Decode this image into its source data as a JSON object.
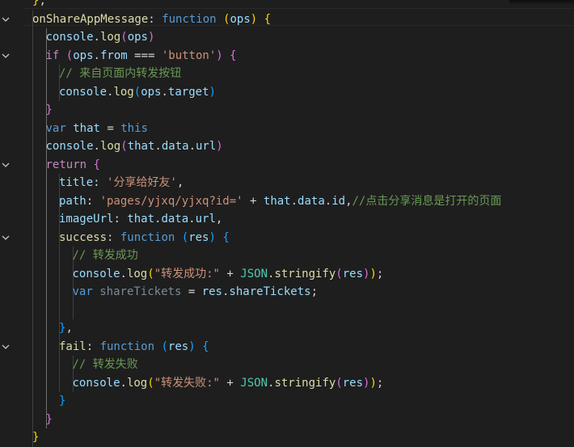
{
  "code_lines": [
    "},",
    "onShareAppMessage: function (ops) {",
    "console.log(ops)",
    "if (ops.from === 'button') {",
    "// 来自页面内转发按钮",
    "console.log(ops.target)",
    "}",
    "var that = this",
    "console.log(that.data.url)",
    "return {",
    "title: '分享给好友',",
    "path: 'pages/yjxq/yjxq?id=' + that.data.id,//点击分享消息是打开的页面",
    "imageUrl: that.data.url,",
    "success: function (res) {",
    "// 转发成功",
    "console.log(\"转发成功:\" + JSON.stringify(res));",
    "var shareTickets = res.shareTickets;",
    "",
    "},",
    "fail: function (res) {",
    "// 转发失败",
    "console.log(\"转发失败:\" + JSON.stringify(res));",
    "}",
    "}",
    "}"
  ],
  "fold_markers": [
    1,
    3,
    9,
    13,
    19
  ],
  "colors": {
    "background": "#1e1e1e",
    "function": "#dcdcaa",
    "keyword": "#569cd6",
    "property": "#9cdcfe",
    "string": "#ce9178",
    "comment": "#6a9955",
    "class": "#4ec9b0",
    "bracket_gold": "#ffd700",
    "bracket_purple": "#da70d6",
    "bracket_blue": "#179fff"
  }
}
